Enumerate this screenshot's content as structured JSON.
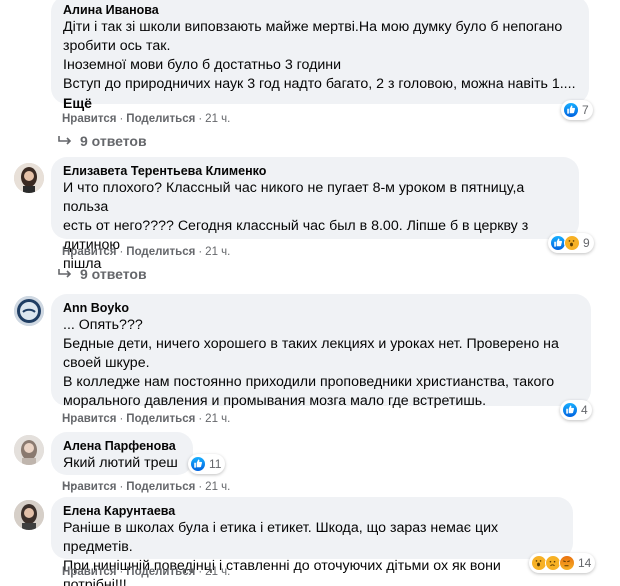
{
  "reply_arrow_color": "#65676b",
  "comments": [
    {
      "author": "Алина Иванова",
      "lines": [
        "Діти і так зі школи виповзають майже мертві.На мою думку було б непогано",
        "зробити ось так.",
        "Іноземної мови було б достатньо 3 години",
        "Вступ до природничих наук 3 год надто багато, 2 з головою, можна навіть 1...."
      ],
      "more": "Ещё",
      "like": "Нравится",
      "reply": "Поделиться",
      "time": "21 ч.",
      "reactions": {
        "icons": [
          "like"
        ],
        "count": "7"
      },
      "replies": "9 ответов"
    },
    {
      "author": "Елизавета Терентьева Клименко",
      "lines": [
        "И что плохого? Классный час никого не пугает 8-м уроком в пятницу,а польза",
        "есть от него???? Сегодня классный час был в 8.00. Ліпше б в церкву з дитиною",
        "пішла"
      ],
      "like": "Нравится",
      "reply": "Поделиться",
      "time": "21 ч.",
      "reactions": {
        "icons": [
          "like",
          "wow"
        ],
        "count": "9"
      },
      "replies": "9 ответов"
    },
    {
      "author": "Ann Boyko",
      "lines": [
        "... Опять???",
        "Бедные дети, ничего хорошего в таких лекциях и уроках нет. Проверено на",
        "своей шкуре.",
        "В колледже нам постоянно приходили проповедники христианства, такого",
        "морального давления и промывания мозга мало где встретишь."
      ],
      "like": "Нравится",
      "reply": "Поделиться",
      "time": "21 ч.",
      "reactions": {
        "icons": [
          "like"
        ],
        "count": "4"
      }
    },
    {
      "author": "Алена Парфенова",
      "lines": [
        "Який лютий треш ..."
      ],
      "like": "Нравится",
      "reply": "Поделиться",
      "time": "21 ч.",
      "reactions": {
        "icons": [
          "like"
        ],
        "count": "11"
      }
    },
    {
      "author": "Елена Карунтаева",
      "lines": [
        "Раніше в школах була і етика і етикет. Шкода, що зараз немає цих предметів.",
        "При нинішній поведінці і ставленні до оточуючих дітьми ох як вони потрібні!!!"
      ],
      "like": "Нравится",
      "reply": "Поделиться",
      "time": "21 ч.",
      "reactions": {
        "icons": [
          "wow",
          "sad",
          "angry"
        ],
        "count": "14"
      }
    }
  ]
}
